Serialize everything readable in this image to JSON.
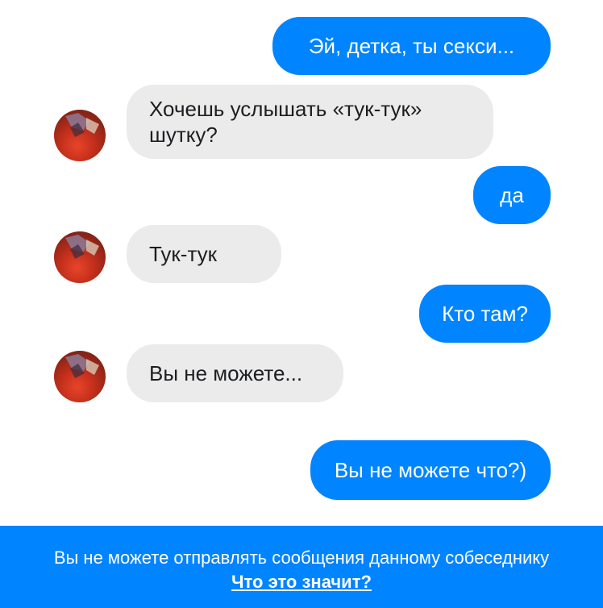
{
  "colors": {
    "outgoing_bubble": "#0084ff",
    "incoming_bubble": "#ebebeb",
    "footer_background": "#0084ff"
  },
  "messages": [
    {
      "direction": "outgoing",
      "text": "Эй, детка, ты секси..."
    },
    {
      "direction": "incoming",
      "text": "Хочешь услышать «тук-тук»\nшутку?"
    },
    {
      "direction": "outgoing",
      "text": "да"
    },
    {
      "direction": "incoming",
      "text": "Тук-тук"
    },
    {
      "direction": "outgoing",
      "text": "Кто там?"
    },
    {
      "direction": "incoming",
      "text": "Вы не можете..."
    },
    {
      "direction": "outgoing",
      "text": "Вы не можете что?)"
    }
  ],
  "footer": {
    "notice": "Вы не можете отправлять сообщения данному собеседнику",
    "link": "Что это значит?"
  }
}
